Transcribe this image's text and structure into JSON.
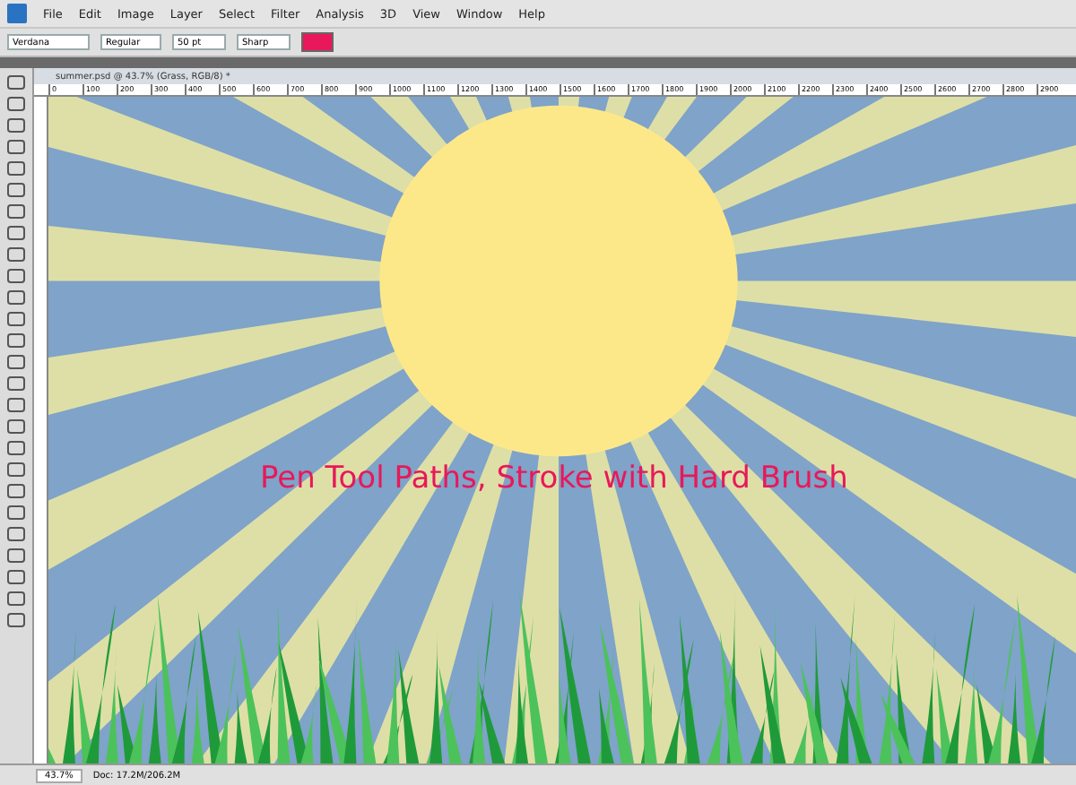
{
  "menu_bar": {
    "items": [
      "File",
      "Edit",
      "Image",
      "Layer",
      "Select",
      "Filter",
      "Analysis",
      "3D",
      "View",
      "Window",
      "Help"
    ]
  },
  "options_bar": {
    "font_family": "Verdana",
    "font_style": "Regular",
    "font_size": "50 pt",
    "anti_alias": "Sharp"
  },
  "document": {
    "tab_title": "summer.psd @ 43.7% (Grass, RGB/8) *",
    "ruler_labels": [
      "0",
      "100",
      "200",
      "300",
      "400",
      "500",
      "600",
      "700",
      "800",
      "900",
      "1000",
      "1100",
      "1200",
      "1300",
      "1400",
      "1500",
      "1600",
      "1700",
      "1800",
      "1900",
      "2000",
      "2100",
      "2200",
      "2300",
      "2400",
      "2500",
      "2600",
      "2700",
      "2800",
      "2900"
    ],
    "canvas_text": "Pen Tool Paths, Stroke with Hard Brush"
  },
  "status_bar": {
    "zoom": "43.7%",
    "doc_info": "Doc: 17.2M/206.2M"
  }
}
